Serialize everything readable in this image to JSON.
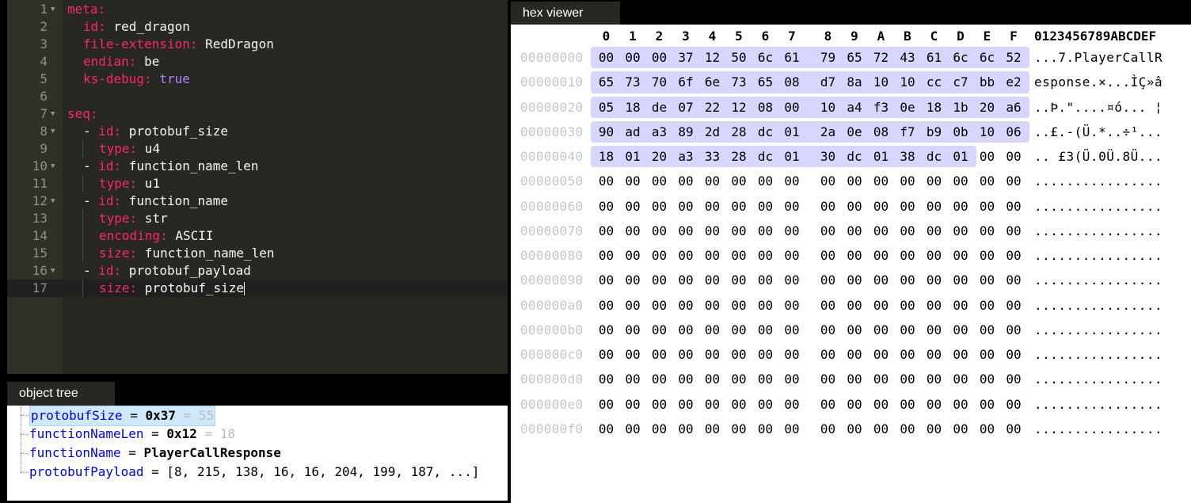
{
  "editor": {
    "lines": [
      {
        "num": "1",
        "fold": true,
        "indent": 0,
        "parts": [
          {
            "t": "meta:",
            "c": "key"
          }
        ]
      },
      {
        "num": "2",
        "fold": false,
        "indent": 1,
        "parts": [
          {
            "t": "id:",
            "c": "key"
          },
          {
            "t": " red_dragon",
            "c": "val"
          }
        ]
      },
      {
        "num": "3",
        "fold": false,
        "indent": 1,
        "parts": [
          {
            "t": "file-extension:",
            "c": "key"
          },
          {
            "t": " RedDragon",
            "c": "val"
          }
        ]
      },
      {
        "num": "4",
        "fold": false,
        "indent": 1,
        "parts": [
          {
            "t": "endian:",
            "c": "key"
          },
          {
            "t": " be",
            "c": "val"
          }
        ]
      },
      {
        "num": "5",
        "fold": false,
        "indent": 1,
        "parts": [
          {
            "t": "ks-debug:",
            "c": "key"
          },
          {
            "t": " true",
            "c": "kw"
          }
        ]
      },
      {
        "num": "6",
        "fold": false,
        "indent": 0,
        "parts": []
      },
      {
        "num": "7",
        "fold": true,
        "indent": 0,
        "parts": [
          {
            "t": "seq:",
            "c": "key"
          }
        ]
      },
      {
        "num": "8",
        "fold": true,
        "indent": 1,
        "parts": [
          {
            "t": "- ",
            "c": "val"
          },
          {
            "t": "id:",
            "c": "key"
          },
          {
            "t": " protobuf_size",
            "c": "val"
          }
        ]
      },
      {
        "num": "9",
        "fold": false,
        "indent": 2,
        "parts": [
          {
            "t": "type:",
            "c": "key"
          },
          {
            "t": " u4",
            "c": "val"
          }
        ]
      },
      {
        "num": "10",
        "fold": true,
        "indent": 1,
        "parts": [
          {
            "t": "- ",
            "c": "val"
          },
          {
            "t": "id:",
            "c": "key"
          },
          {
            "t": " function_name_len",
            "c": "val"
          }
        ]
      },
      {
        "num": "11",
        "fold": false,
        "indent": 2,
        "parts": [
          {
            "t": "type:",
            "c": "key"
          },
          {
            "t": " u1",
            "c": "val"
          }
        ]
      },
      {
        "num": "12",
        "fold": true,
        "indent": 1,
        "parts": [
          {
            "t": "- ",
            "c": "val"
          },
          {
            "t": "id:",
            "c": "key"
          },
          {
            "t": " function_name",
            "c": "val"
          }
        ]
      },
      {
        "num": "13",
        "fold": false,
        "indent": 2,
        "parts": [
          {
            "t": "type:",
            "c": "key"
          },
          {
            "t": " str",
            "c": "val"
          }
        ]
      },
      {
        "num": "14",
        "fold": false,
        "indent": 2,
        "parts": [
          {
            "t": "encoding:",
            "c": "key"
          },
          {
            "t": " ASCII",
            "c": "val"
          }
        ]
      },
      {
        "num": "15",
        "fold": false,
        "indent": 2,
        "parts": [
          {
            "t": "size:",
            "c": "key"
          },
          {
            "t": " function_name_len",
            "c": "val"
          }
        ]
      },
      {
        "num": "16",
        "fold": true,
        "indent": 1,
        "parts": [
          {
            "t": "- ",
            "c": "val"
          },
          {
            "t": "id:",
            "c": "key"
          },
          {
            "t": " protobuf_payload",
            "c": "val"
          }
        ]
      },
      {
        "num": "17",
        "fold": false,
        "indent": 2,
        "active": true,
        "cursor": true,
        "parts": [
          {
            "t": "size:",
            "c": "key"
          },
          {
            "t": " protobuf_size",
            "c": "val"
          }
        ]
      }
    ]
  },
  "object_tree": {
    "tab_label": "object tree",
    "items": [
      {
        "name": "protobufSize",
        "eq": " = ",
        "bold": "0x37",
        "extra": " = 55",
        "selected": true
      },
      {
        "name": "functionNameLen",
        "eq": " = ",
        "bold": "0x12",
        "extra": " = 18",
        "selected": false
      },
      {
        "name": "functionName",
        "eq": " = ",
        "bold": "PlayerCallResponse",
        "extra": "",
        "selected": false
      },
      {
        "name": "protobufPayload",
        "eq": " = ",
        "plain": "[8, 215, 138, 16, 16, 204, 199, 187, ...]",
        "bold": "",
        "extra": "",
        "selected": false
      }
    ]
  },
  "hex_viewer": {
    "tab_label": "hex viewer",
    "col_headers": [
      "0",
      "1",
      "2",
      "3",
      "4",
      "5",
      "6",
      "7",
      "8",
      "9",
      "A",
      "B",
      "C",
      "D",
      "E",
      "F"
    ],
    "ascii_header": "0123456789ABCDEF",
    "rows": [
      {
        "addr": "00000000",
        "bytes": [
          "00",
          "00",
          "00",
          "37",
          "12",
          "50",
          "6c",
          "61",
          "79",
          "65",
          "72",
          "43",
          "61",
          "6c",
          "6c",
          "52"
        ],
        "ascii": "...7.PlayerCallR"
      },
      {
        "addr": "00000010",
        "bytes": [
          "65",
          "73",
          "70",
          "6f",
          "6e",
          "73",
          "65",
          "08",
          "d7",
          "8a",
          "10",
          "10",
          "cc",
          "c7",
          "bb",
          "e2"
        ],
        "ascii": "esponse.×...ÌÇ»â"
      },
      {
        "addr": "00000020",
        "bytes": [
          "05",
          "18",
          "de",
          "07",
          "22",
          "12",
          "08",
          "00",
          "10",
          "a4",
          "f3",
          "0e",
          "18",
          "1b",
          "20",
          "a6"
        ],
        "ascii": "..Þ.\"....¤ó... ¦"
      },
      {
        "addr": "00000030",
        "bytes": [
          "90",
          "ad",
          "a3",
          "89",
          "2d",
          "28",
          "dc",
          "01",
          "2a",
          "0e",
          "08",
          "f7",
          "b9",
          "0b",
          "10",
          "06"
        ],
        "ascii": "..£.-(Ü.*..÷¹..."
      },
      {
        "addr": "00000040",
        "bytes": [
          "18",
          "01",
          "20",
          "a3",
          "33",
          "28",
          "dc",
          "01",
          "30",
          "dc",
          "01",
          "38",
          "dc",
          "01",
          "00",
          "00"
        ],
        "ascii": ".. £3(Ü.0Ü.8Ü..."
      },
      {
        "addr": "00000050",
        "bytes": [
          "00",
          "00",
          "00",
          "00",
          "00",
          "00",
          "00",
          "00",
          "00",
          "00",
          "00",
          "00",
          "00",
          "00",
          "00",
          "00"
        ],
        "ascii": "................"
      },
      {
        "addr": "00000060",
        "bytes": [
          "00",
          "00",
          "00",
          "00",
          "00",
          "00",
          "00",
          "00",
          "00",
          "00",
          "00",
          "00",
          "00",
          "00",
          "00",
          "00"
        ],
        "ascii": "................"
      },
      {
        "addr": "00000070",
        "bytes": [
          "00",
          "00",
          "00",
          "00",
          "00",
          "00",
          "00",
          "00",
          "00",
          "00",
          "00",
          "00",
          "00",
          "00",
          "00",
          "00"
        ],
        "ascii": "................"
      },
      {
        "addr": "00000080",
        "bytes": [
          "00",
          "00",
          "00",
          "00",
          "00",
          "00",
          "00",
          "00",
          "00",
          "00",
          "00",
          "00",
          "00",
          "00",
          "00",
          "00"
        ],
        "ascii": "................"
      },
      {
        "addr": "00000090",
        "bytes": [
          "00",
          "00",
          "00",
          "00",
          "00",
          "00",
          "00",
          "00",
          "00",
          "00",
          "00",
          "00",
          "00",
          "00",
          "00",
          "00"
        ],
        "ascii": "................"
      },
      {
        "addr": "000000a0",
        "bytes": [
          "00",
          "00",
          "00",
          "00",
          "00",
          "00",
          "00",
          "00",
          "00",
          "00",
          "00",
          "00",
          "00",
          "00",
          "00",
          "00"
        ],
        "ascii": "................"
      },
      {
        "addr": "000000b0",
        "bytes": [
          "00",
          "00",
          "00",
          "00",
          "00",
          "00",
          "00",
          "00",
          "00",
          "00",
          "00",
          "00",
          "00",
          "00",
          "00",
          "00"
        ],
        "ascii": "................"
      },
      {
        "addr": "000000c0",
        "bytes": [
          "00",
          "00",
          "00",
          "00",
          "00",
          "00",
          "00",
          "00",
          "00",
          "00",
          "00",
          "00",
          "00",
          "00",
          "00",
          "00"
        ],
        "ascii": "................"
      },
      {
        "addr": "000000d0",
        "bytes": [
          "00",
          "00",
          "00",
          "00",
          "00",
          "00",
          "00",
          "00",
          "00",
          "00",
          "00",
          "00",
          "00",
          "00",
          "00",
          "00"
        ],
        "ascii": "................"
      },
      {
        "addr": "000000e0",
        "bytes": [
          "00",
          "00",
          "00",
          "00",
          "00",
          "00",
          "00",
          "00",
          "00",
          "00",
          "00",
          "00",
          "00",
          "00",
          "00",
          "00"
        ],
        "ascii": "................"
      },
      {
        "addr": "000000f0",
        "bytes": [
          "00",
          "00",
          "00",
          "00",
          "00",
          "00",
          "00",
          "00",
          "00",
          "00",
          "00",
          "00",
          "00",
          "00",
          "00",
          "00"
        ],
        "ascii": "................"
      }
    ],
    "highlights": [
      {
        "row": 0,
        "start": 0,
        "end": 3
      },
      {
        "row": 0,
        "start": 4,
        "end": 4
      },
      {
        "row": 0,
        "start": 5,
        "end": 15
      },
      {
        "row": 1,
        "start": 0,
        "end": 6
      },
      {
        "row": 1,
        "start": 7,
        "end": 15
      },
      {
        "row": 2,
        "start": 0,
        "end": 15
      },
      {
        "row": 3,
        "start": 0,
        "end": 15
      },
      {
        "row": 4,
        "start": 0,
        "end": 13
      }
    ],
    "colors": {
      "highlight": "#d7d6ff"
    }
  }
}
